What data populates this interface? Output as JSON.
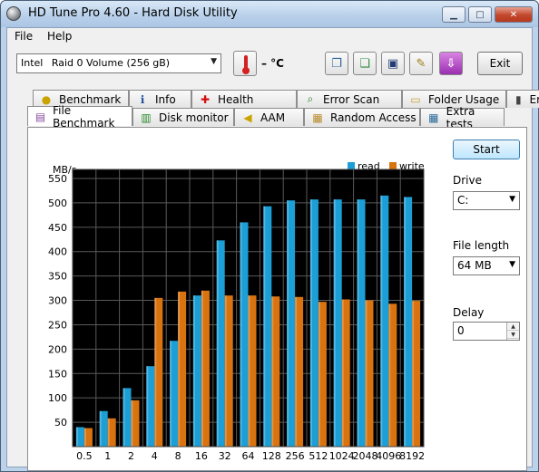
{
  "window": {
    "title": "HD Tune Pro 4.60 - Hard Disk Utility"
  },
  "menu": {
    "file": "File",
    "help": "Help"
  },
  "toolbar": {
    "drive_brand": "Intel",
    "drive_name": "Raid 0 Volume (256 gB)",
    "temperature": "– °C",
    "exit_label": "Exit",
    "icons": [
      "copy-info-icon",
      "copy-screenshot-icon",
      "save-icon",
      "options-icon",
      "download-icon"
    ]
  },
  "tabs_top": [
    {
      "label": "Benchmark",
      "icon": "benchmark-icon"
    },
    {
      "label": "Info",
      "icon": "info-icon"
    },
    {
      "label": "Health",
      "icon": "health-icon"
    },
    {
      "label": "Error Scan",
      "icon": "error-scan-icon"
    },
    {
      "label": "Folder Usage",
      "icon": "folder-icon"
    },
    {
      "label": "Erase",
      "icon": "erase-icon"
    }
  ],
  "tabs_bottom": [
    {
      "label": "File Benchmark",
      "icon": "file-benchmark-icon",
      "active": true
    },
    {
      "label": "Disk monitor",
      "icon": "disk-monitor-icon"
    },
    {
      "label": "AAM",
      "icon": "aam-icon"
    },
    {
      "label": "Random Access",
      "icon": "random-access-icon"
    },
    {
      "label": "Extra tests",
      "icon": "extra-tests-icon"
    }
  ],
  "controls": {
    "start_label": "Start",
    "drive_label": "Drive",
    "drive_value": "C:",
    "file_length_label": "File length",
    "file_length_value": "64 MB",
    "delay_label": "Delay",
    "delay_value": "0"
  },
  "chart_data": {
    "type": "bar",
    "ylabel": "MB/s",
    "ylim": [
      0,
      550
    ],
    "yticks": [
      50,
      100,
      150,
      200,
      250,
      300,
      350,
      400,
      450,
      500,
      550
    ],
    "categories": [
      "0.5",
      "1",
      "2",
      "4",
      "8",
      "16",
      "32",
      "64",
      "128",
      "256",
      "512",
      "1024",
      "2048",
      "4096",
      "8192"
    ],
    "series": [
      {
        "name": "read",
        "color": "#1b9fd6",
        "values": [
          40,
          73,
          120,
          165,
          217,
          310,
          423,
          460,
          493,
          505,
          507,
          507,
          507,
          515,
          512
        ]
      },
      {
        "name": "write",
        "color": "#d9730f",
        "values": [
          38,
          58,
          95,
          305,
          318,
          320,
          310,
          310,
          308,
          307,
          297,
          302,
          300,
          293,
          299
        ]
      }
    ],
    "grid": true,
    "legend": "top-right"
  }
}
